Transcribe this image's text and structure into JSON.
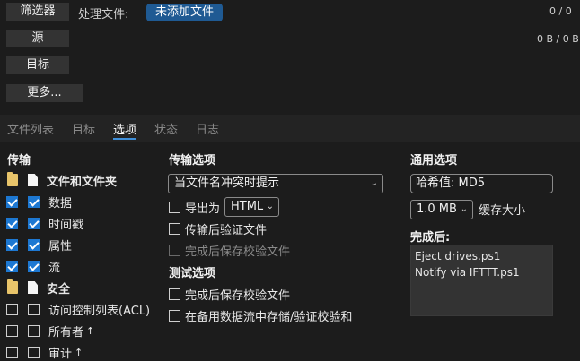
{
  "top": {
    "filter_label": "筛选器",
    "source_label": "源",
    "target_label": "目标",
    "more_label": "更多...",
    "processing_label": "处理文件:",
    "status_pill": "未添加文件",
    "count": "0 / 0",
    "bytes": "0 B / 0 B"
  },
  "tabs": [
    {
      "label": "文件列表",
      "active": false
    },
    {
      "label": "目标",
      "active": false
    },
    {
      "label": "选项",
      "active": true
    },
    {
      "label": "状态",
      "active": false
    },
    {
      "label": "日志",
      "active": false
    }
  ],
  "transfer": {
    "title": "传输",
    "items": [
      {
        "label": "文件和文件夹",
        "bold": true
      },
      {
        "label": "数据",
        "checked": true
      },
      {
        "label": "时间戳",
        "checked": true
      },
      {
        "label": "属性",
        "checked": true
      },
      {
        "label": "流",
        "checked": true
      },
      {
        "label": "安全",
        "bold": true
      },
      {
        "label": "访问控制列表(ACL)",
        "checked": false
      },
      {
        "label": "所有者",
        "checked": false,
        "suffix": "↑"
      },
      {
        "label": "审计",
        "checked": false,
        "suffix": "↑"
      }
    ]
  },
  "transfer_options": {
    "title": "传输选项",
    "conflict_value": "当文件名冲突时提示",
    "export_label": "导出为",
    "export_format": "HTML",
    "verify_label": "传输后验证文件",
    "save_checksum_label": "完成后保存校验文件"
  },
  "test_options": {
    "title": "测试选项",
    "save_checksum_label": "完成后保存校验文件",
    "alt_stream_label": "在备用数据流中存储/验证校验和"
  },
  "general": {
    "title": "通用选项",
    "hash_value": "哈希值: MD5",
    "cache_value": "1.0 MB",
    "cache_label": "缓存大小",
    "after_title": "完成后:",
    "after_items": [
      "Eject drives.ps1",
      "Notify via IFTTT.ps1"
    ]
  },
  "colors": {
    "accent": "#1d78d2",
    "pill": "#1f5a93",
    "background": "#1c1c1c"
  }
}
